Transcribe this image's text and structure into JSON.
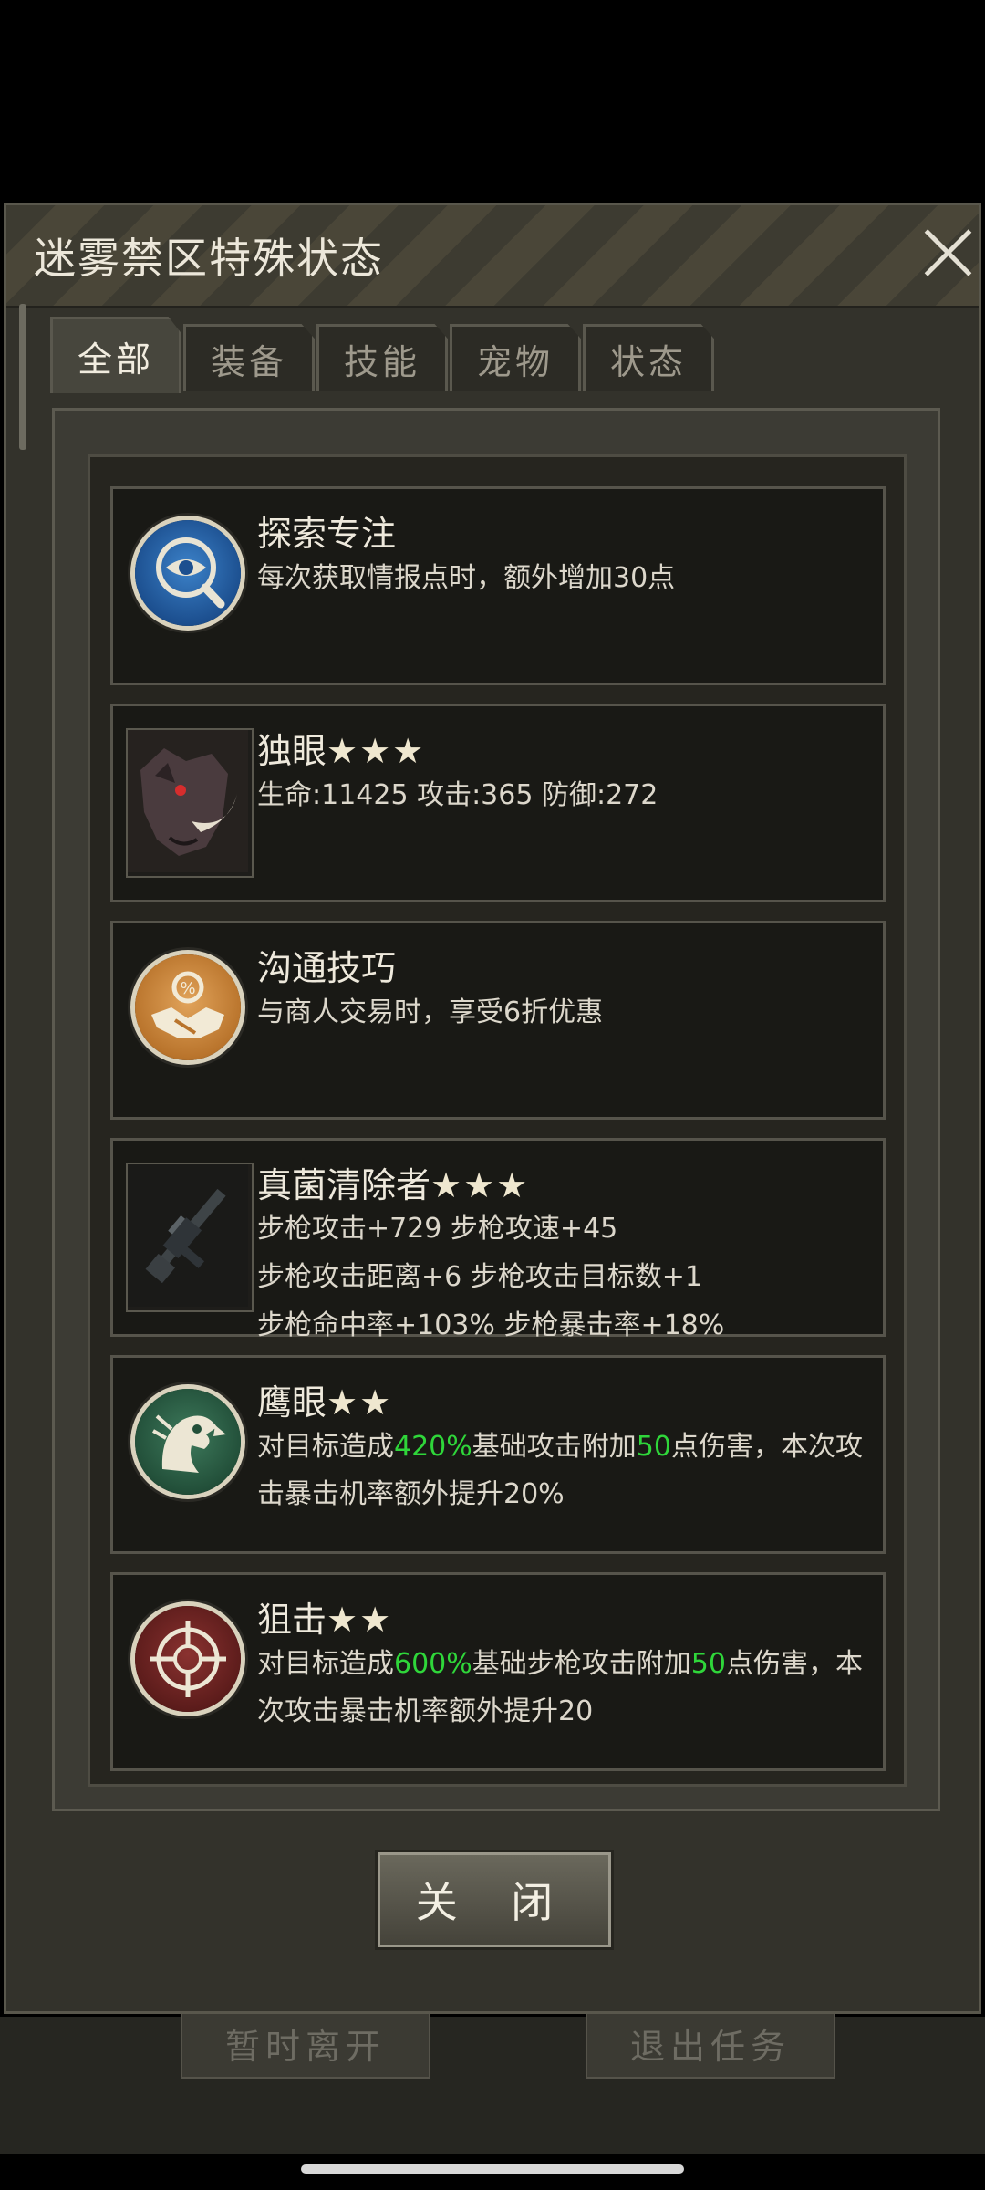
{
  "background": {
    "left_button": "暂时离开",
    "right_button": "退出任务"
  },
  "dialog": {
    "title": "迷雾禁区特殊状态",
    "tabs": [
      {
        "label": "全部",
        "active": true
      },
      {
        "label": "装备",
        "active": false
      },
      {
        "label": "技能",
        "active": false
      },
      {
        "label": "宠物",
        "active": false
      },
      {
        "label": "状态",
        "active": false
      }
    ],
    "close_button": "关 闭"
  },
  "items": [
    {
      "title": "探索专注",
      "stars": "",
      "icon": "eye-magnifier-icon",
      "desc": "每次获取情报点时，额外增加30点"
    },
    {
      "title": "独眼",
      "stars": "★★★",
      "icon": "boar-portrait",
      "desc": "生命:11425  攻击:365  防御:272"
    },
    {
      "title": "沟通技巧",
      "stars": "",
      "icon": "handshake-icon",
      "desc": "与商人交易时，享受6折优惠"
    },
    {
      "title": "真菌清除者",
      "stars": "★★★",
      "icon": "rifle-icon",
      "desc_lines": [
        "步枪攻击+729  步枪攻速+45",
        "步枪攻击距离+6  步枪攻击目标数+1",
        "步枪命中率+103%  步枪暴击率+18%"
      ]
    },
    {
      "title": "鹰眼",
      "stars": "★★",
      "icon": "eagle-icon",
      "desc_parts": [
        "对目标造成",
        "420%",
        "基础攻击附加",
        "50",
        "点伤害，本次攻击暴击机率额外提升20%"
      ]
    },
    {
      "title": "狙击",
      "stars": "★★",
      "icon": "crosshair-icon",
      "desc_parts": [
        "对目标造成",
        "600%",
        "基础步枪攻击附加",
        "50",
        "点伤害，本次攻击暴击机率额外提升20"
      ]
    }
  ],
  "colors": {
    "highlight": "#2fd63a",
    "panel": "#26251f",
    "card": "#191915"
  }
}
